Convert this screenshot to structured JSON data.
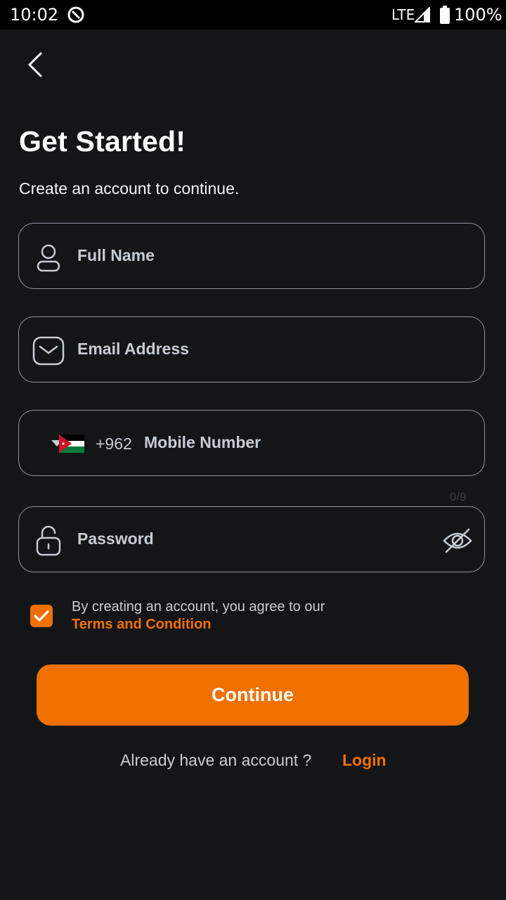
{
  "status_bar": {
    "time": "10:02",
    "network": "LTE",
    "battery": "100%"
  },
  "page": {
    "title": "Get Started!",
    "subtitle": "Create an account to continue."
  },
  "form": {
    "full_name_placeholder": "Full Name",
    "email_placeholder": "Email Address",
    "country_code": "+962",
    "mobile_placeholder": "Mobile Number",
    "mobile_counter": "0/9",
    "password_placeholder": "Password"
  },
  "agreement": {
    "checked": true,
    "text": "By creating an account, you agree to our",
    "link": "Terms and Condition"
  },
  "actions": {
    "continue_label": "Continue",
    "already_text": "Already have an account ?",
    "login_label": "Login"
  },
  "colors": {
    "accent": "#f07000",
    "background": "#141517",
    "border": "#8e939b",
    "placeholder": "#c5ccd6"
  },
  "icons": [
    "back-chevron-icon",
    "person-icon",
    "mail-icon",
    "dropdown-caret-icon",
    "jordan-flag-icon",
    "lock-open-icon",
    "eye-off-icon",
    "checkmark-icon",
    "signal-icon",
    "battery-icon"
  ]
}
